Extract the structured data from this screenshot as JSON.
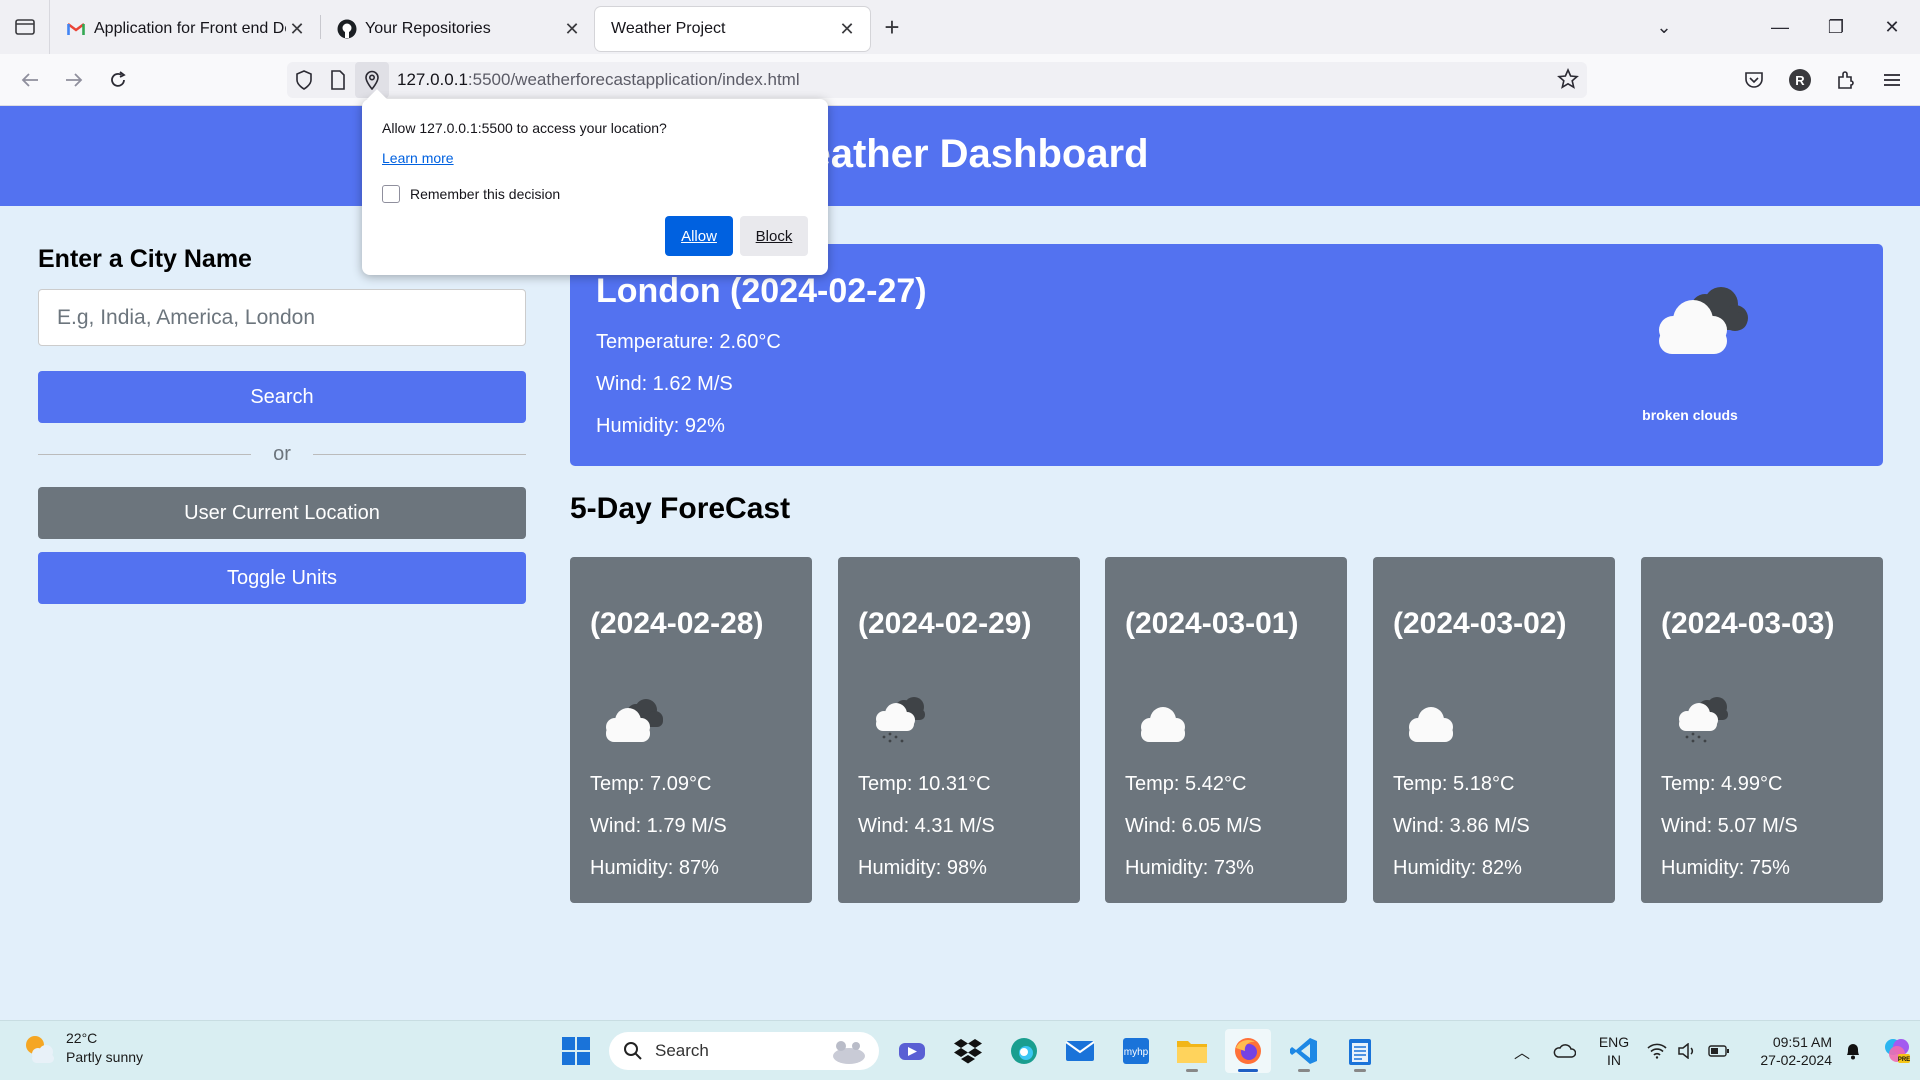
{
  "browser": {
    "tabs": [
      {
        "title": "Application for Front end Devel",
        "favicon": "gmail-icon"
      },
      {
        "title": "Your Repositories",
        "favicon": "github-icon"
      },
      {
        "title": "Weather Project",
        "favicon": "none",
        "active": true
      }
    ],
    "url_host": "127.0.0.1",
    "url_rest": ":5500/weatherforecastapplication/index.html",
    "profile_initial": "R"
  },
  "permission_popup": {
    "question": "Allow 127.0.0.1:5500 to access your location?",
    "learn_more": "Learn more",
    "remember": "Remember this decision",
    "allow": "Allow",
    "block": "Block"
  },
  "page": {
    "title": "Weather Dashboard",
    "sidebar": {
      "heading": "Enter a City Name",
      "input_placeholder": "E.g, India, America, London",
      "search_label": "Search",
      "or_label": "or",
      "location_label": "User Current Location",
      "toggle_label": "Toggle Units"
    },
    "current": {
      "title": "London (2024-02-27)",
      "temperature": "Temperature: 2.60°C",
      "wind": "Wind: 1.62 M/S",
      "humidity": "Humidity: 92%",
      "description": "broken clouds",
      "icon": "broken-clouds-icon"
    },
    "forecast_title": "5-Day ForeCast",
    "forecast": [
      {
        "date": "(2024-02-28)",
        "icon": "broken-clouds-icon",
        "temp": "Temp: 7.09°C",
        "wind": "Wind: 1.79 M/S",
        "humidity": "Humidity: 87%"
      },
      {
        "date": "(2024-02-29)",
        "icon": "rain-cloud-icon",
        "temp": "Temp: 10.31°C",
        "wind": "Wind: 4.31 M/S",
        "humidity": "Humidity: 98%"
      },
      {
        "date": "(2024-03-01)",
        "icon": "cloud-icon",
        "temp": "Temp: 5.42°C",
        "wind": "Wind: 6.05 M/S",
        "humidity": "Humidity: 73%"
      },
      {
        "date": "(2024-03-02)",
        "icon": "cloud-icon",
        "temp": "Temp: 5.18°C",
        "wind": "Wind: 3.86 M/S",
        "humidity": "Humidity: 82%"
      },
      {
        "date": "(2024-03-03)",
        "icon": "rain-cloud-icon",
        "temp": "Temp: 4.99°C",
        "wind": "Wind: 5.07 M/S",
        "humidity": "Humidity: 75%"
      }
    ]
  },
  "taskbar": {
    "weather_temp": "22°C",
    "weather_desc": "Partly sunny",
    "search_label": "Search",
    "lang_1": "ENG",
    "lang_2": "IN",
    "time": "09:51 AM",
    "date": "27-02-2024"
  },
  "colors": {
    "primary": "#5372f0",
    "secondary": "#6c757d",
    "background": "#e2effa"
  }
}
